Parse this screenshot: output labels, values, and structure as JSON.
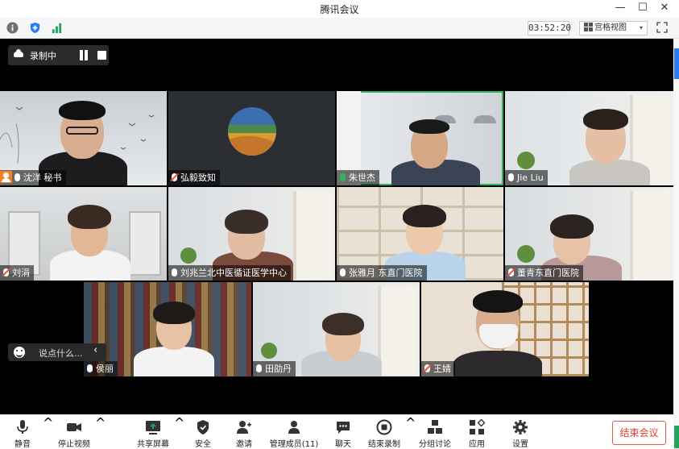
{
  "window": {
    "title": "腾讯会议",
    "minimize": "—",
    "maximize": "☐",
    "close": "✕"
  },
  "infobar": {
    "timer": "03:52:20",
    "view_label": "宫格视图",
    "view_caret": "▾",
    "colors": {
      "info": "#707070",
      "shield": "#2a7cf6",
      "signal": "#1fa45e"
    }
  },
  "recording": {
    "label": "录制中"
  },
  "participants": [
    {
      "name": "沈洋 秘书",
      "host": true,
      "mic": "on"
    },
    {
      "name": "弘毅致知",
      "host": false,
      "mic": "muted"
    },
    {
      "name": "朱世杰",
      "host": false,
      "mic": "on",
      "speaking": true
    },
    {
      "name": "Jie Liu",
      "host": false,
      "mic": "on"
    },
    {
      "name": "刘涓",
      "host": false,
      "mic": "muted"
    },
    {
      "name": "刘兆兰北中医循证医学中心",
      "host": false,
      "mic": "on"
    },
    {
      "name": "张雅月 东直门医院",
      "host": false,
      "mic": "on"
    },
    {
      "name": "董青东直门医院",
      "host": false,
      "mic": "muted"
    },
    {
      "name": "侯丽",
      "host": false,
      "mic": "on"
    },
    {
      "name": "田劭丹",
      "host": false,
      "mic": "on"
    },
    {
      "name": "王婧",
      "host": false,
      "mic": "muted"
    }
  ],
  "chat": {
    "placeholder": "说点什么...",
    "collapse": "‹"
  },
  "toolbar": {
    "mute": "静音",
    "stop_video": "停止视频",
    "share": "共享屏幕",
    "security": "安全",
    "invite": "邀请",
    "members": "管理成员(11)",
    "chat": "聊天",
    "end_recording": "结束录制",
    "breakout": "分组讨论",
    "apps": "应用",
    "settings": "设置",
    "end_meeting": "结束会议",
    "caret": "^"
  }
}
